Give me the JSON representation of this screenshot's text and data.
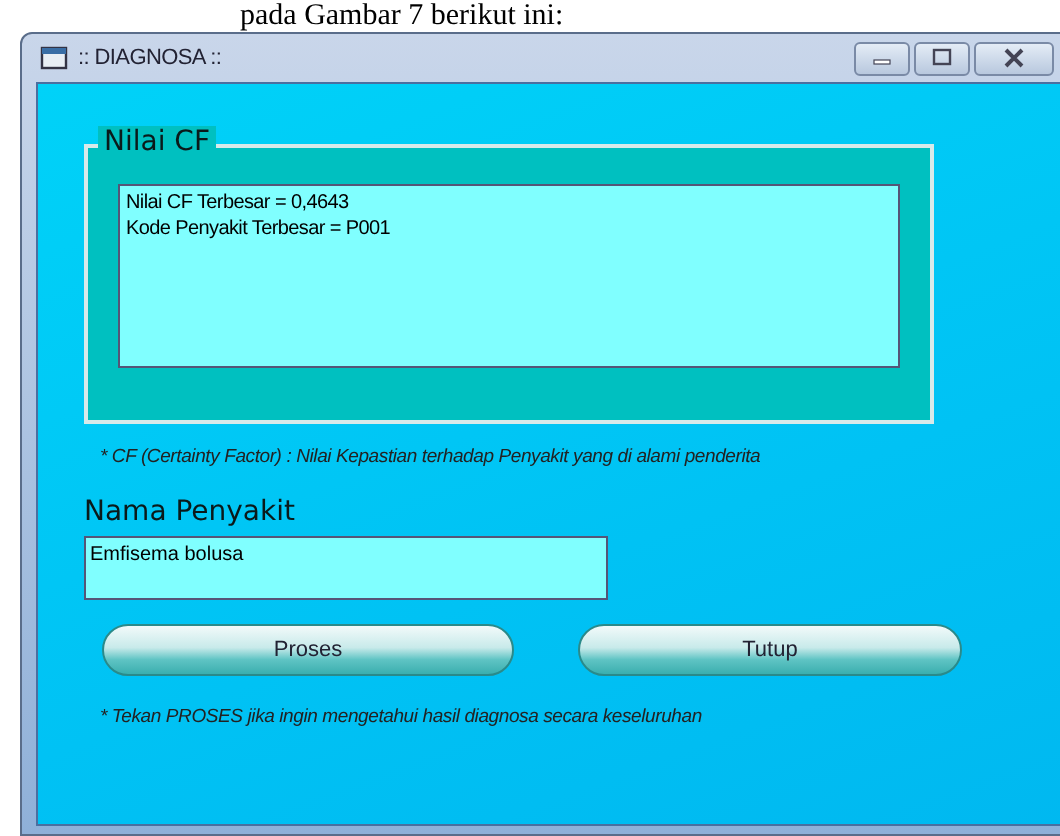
{
  "document_text": "pada Gambar 7 berikut ini:",
  "window": {
    "title": ":: DIAGNOSA ::"
  },
  "cf_group": {
    "title": "Nilai CF",
    "lines": [
      "Nilai CF Terbesar = 0,4643",
      "Kode Penyakit Terbesar = P001"
    ]
  },
  "cf_note": "* CF (Certainty Factor) : Nilai Kepastian terhadap Penyakit yang di alami penderita",
  "disease": {
    "label": "Nama Penyakit",
    "value": "Emfisema bolusa"
  },
  "buttons": [
    "Proses",
    "Tutup"
  ],
  "footer_note": "* Tekan PROSES jika ingin mengetahui hasil diagnosa secara keseluruhan"
}
